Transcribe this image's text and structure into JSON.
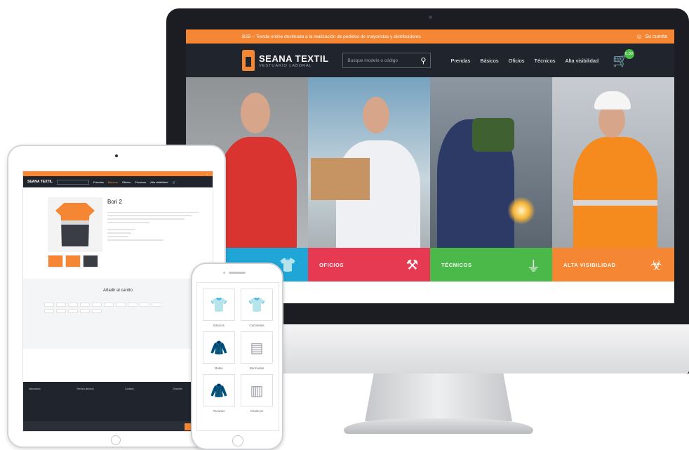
{
  "desktop": {
    "topbar": {
      "message": "B2B – Tienda online destinada a la realización de pedidos de mayoristas y distribuidores",
      "account_label": "Su cuenta",
      "account_icon": "user-icon"
    },
    "header": {
      "logo_title": "SEANA TEXTIL",
      "logo_subtitle": "VESTUARIO LABORAL",
      "search_placeholder": "Busque modelo o código",
      "search_icon": "search-icon",
      "menu": [
        "Prendas",
        "Básicos",
        "Oficios",
        "Técnicos",
        "Alta visibilidad"
      ],
      "cart_icon": "cart-icon",
      "cart_badge": "0,00"
    },
    "categories": [
      {
        "label": "",
        "icon": "shirt-icon",
        "color": "#1fa6d6"
      },
      {
        "label": "OFICIOS",
        "icon": "tools-icon",
        "color": "#e63a52"
      },
      {
        "label": "TÉCNICOS",
        "icon": "plug-icon",
        "color": "#4bb84a"
      },
      {
        "label": "ALTA VISIBILIDAD",
        "icon": "beacon-icon",
        "color": "#f58634"
      }
    ]
  },
  "tablet": {
    "logo_title": "SEANA TEXTIL",
    "menu": [
      "Prendas",
      "Básicos",
      "Oficios",
      "Técnicos",
      "Alta visibilidad"
    ],
    "product": {
      "name": "Bori 2",
      "add_to_cart_title": "Añadir al carrito"
    },
    "footer_columns": [
      "Información",
      "Servicio atención",
      "Contacto",
      "Dirección"
    ]
  },
  "phone": {
    "categories": [
      "Básicos",
      "Camisetas",
      "Batas",
      "Bermudas",
      "Tocados",
      "Chalecos"
    ]
  }
}
